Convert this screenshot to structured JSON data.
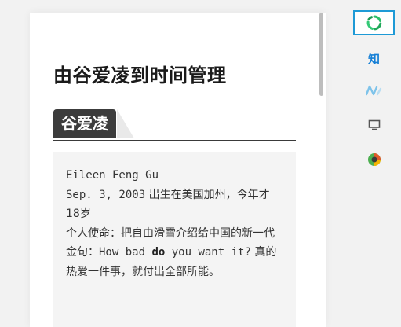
{
  "article": {
    "title": "由谷爱凌到时间管理",
    "section_label": "谷爱凌",
    "bio": {
      "name": "Eileen Feng Gu",
      "birth_date": "Sep. 3, 2003",
      "birth_text": " 出生在美国加州，今年才18岁",
      "mission": "个人使命：把自由滑雪介绍给中国的新一代",
      "quote_prefix": "金句：",
      "quote_a": "How bad ",
      "quote_bold": "do",
      "quote_b": " you want it?",
      "quote_suffix": " 真的热爱一件事，就付出全部所能。"
    }
  },
  "share_sidebar": {
    "items": [
      {
        "icon": "wechat-moments-icon",
        "color": "#2bbf6a",
        "active": true
      },
      {
        "icon": "zhihu-icon",
        "text": "知",
        "color": "#1780d6"
      },
      {
        "icon": "wave-logo-icon",
        "color": "#7ec3ea"
      },
      {
        "icon": "monitor-icon",
        "color": "#555555"
      },
      {
        "icon": "colorful-app-icon",
        "color": "#e05a2a"
      }
    ]
  }
}
